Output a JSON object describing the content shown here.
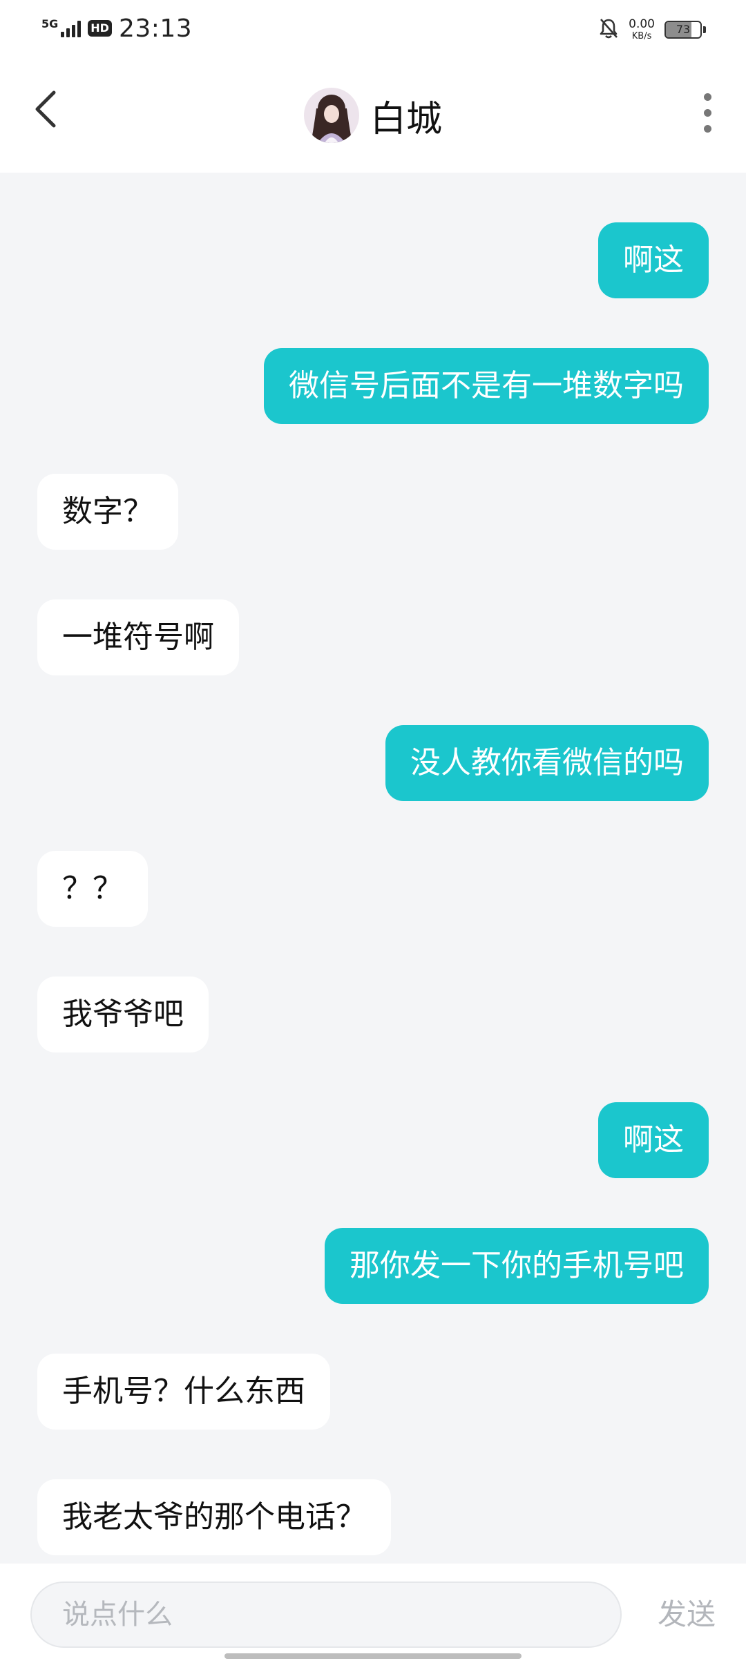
{
  "status_bar": {
    "network": "5G",
    "hd": "HD",
    "time": "23:13",
    "speed_value": "0.00",
    "speed_unit": "KB/s",
    "battery_level": 73,
    "battery_label": "73",
    "icons": [
      "signal-icon",
      "mute-bell-icon",
      "battery-icon"
    ]
  },
  "header": {
    "title": "白城",
    "back_icon": "chevron-left-icon",
    "more_icon": "more-vertical-icon"
  },
  "messages": [
    {
      "from": "me",
      "text": "啊这"
    },
    {
      "from": "me",
      "text": "微信号后面不是有一堆数字吗"
    },
    {
      "from": "other",
      "text": "数字？"
    },
    {
      "from": "other",
      "text": "一堆符号啊"
    },
    {
      "from": "me",
      "text": "没人教你看微信的吗"
    },
    {
      "from": "other",
      "text": "？？"
    },
    {
      "from": "other",
      "text": "我爷爷吧"
    },
    {
      "from": "me",
      "text": "啊这"
    },
    {
      "from": "me",
      "text": "那你发一下你的手机号吧"
    },
    {
      "from": "other",
      "text": "手机号？什么东西"
    },
    {
      "from": "other",
      "text": "我老太爷的那个电话？"
    }
  ],
  "input": {
    "placeholder": "说点什么",
    "value": "",
    "send_label": "发送"
  },
  "colors": {
    "accent": "#1bc6cd",
    "background": "#f4f5f7",
    "bubble_received": "#ffffff"
  }
}
